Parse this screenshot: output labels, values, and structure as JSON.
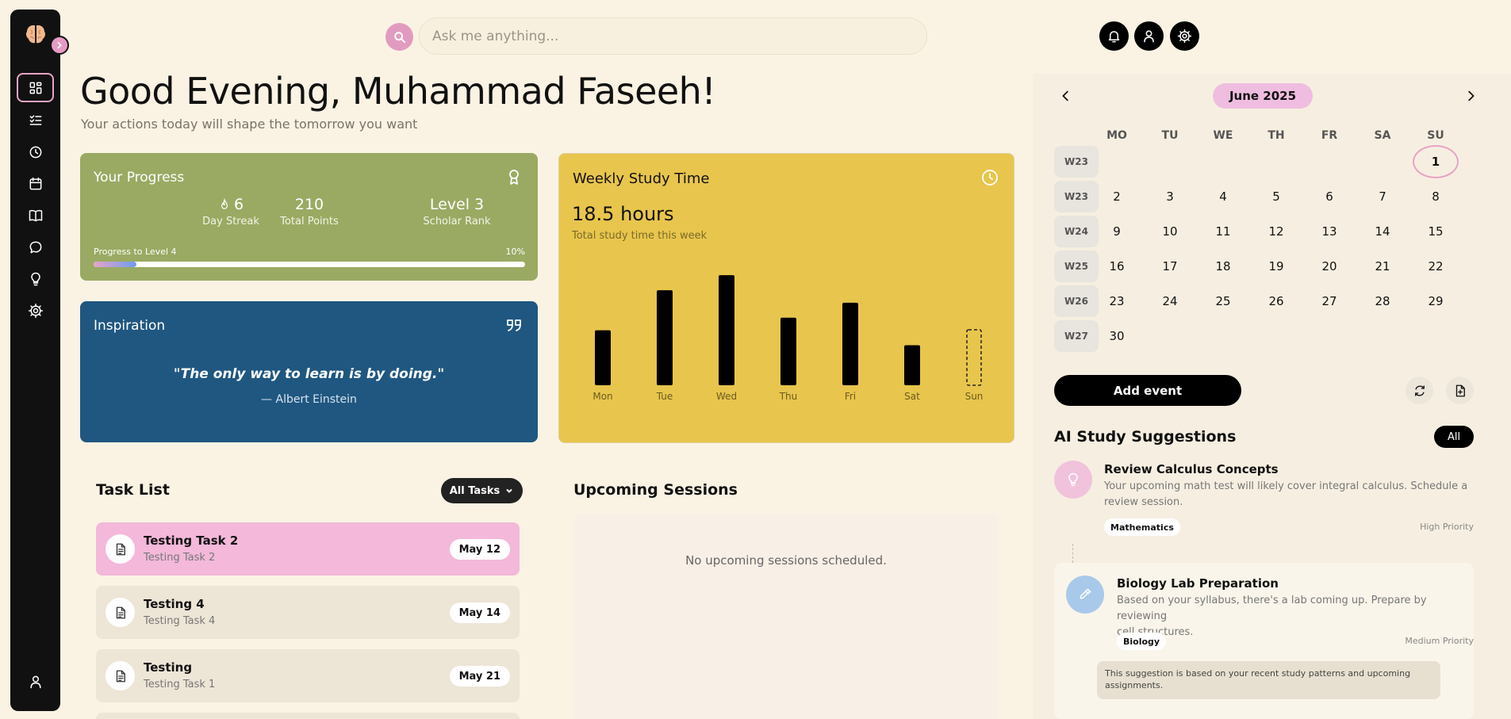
{
  "search": {
    "placeholder": "Ask me anything..."
  },
  "greeting": {
    "title": "Good Evening, Muhammad Faseeh!",
    "subtitle": "Your actions today will shape the tomorrow you want"
  },
  "progress": {
    "title": "Your Progress",
    "stats": [
      {
        "value": "6",
        "label": "Day Streak"
      },
      {
        "value": "210",
        "label": "Total Points"
      },
      {
        "value": "Level 3",
        "label": "Scholar Rank"
      }
    ],
    "bar_label": "Progress to Level 4",
    "bar_percent_text": "10%",
    "bar_fraction": 0.1
  },
  "inspiration": {
    "title": "Inspiration",
    "quote": "\"The only way to learn is by doing.\"",
    "author": "— Albert Einstein"
  },
  "study": {
    "title": "Weekly Study Time",
    "hours": "18.5 hours",
    "subtitle": "Total study time this week"
  },
  "chart_data": {
    "type": "bar",
    "categories": [
      "Mon",
      "Tue",
      "Wed",
      "Thu",
      "Fri",
      "Sat",
      "Sun"
    ],
    "values": [
      2.2,
      3.8,
      4.4,
      2.7,
      3.3,
      1.6,
      0
    ],
    "ylim": [
      0,
      4.5
    ],
    "grid": false,
    "colors": {
      "bar": "#000000",
      "background": "#e8c54c"
    }
  },
  "tasks": {
    "title": "Task List",
    "filter_label": "All Tasks",
    "items": [
      {
        "title": "Testing Task 2",
        "subtitle": "Testing Task 2",
        "date": "May 12"
      },
      {
        "title": "Testing 4",
        "subtitle": "Testing Task 4",
        "date": "May 14"
      },
      {
        "title": "Testing",
        "subtitle": "Testing Task 1",
        "date": "May 21"
      }
    ]
  },
  "upcoming": {
    "title": "Upcoming Sessions",
    "empty_text": "No upcoming sessions scheduled."
  },
  "calendar": {
    "month": "June 2025",
    "weekdays": [
      "MO",
      "TU",
      "WE",
      "TH",
      "FR",
      "SA",
      "SU"
    ],
    "weeks": [
      "W23",
      "W23",
      "W24",
      "W25",
      "W26",
      "W27"
    ],
    "days": [
      [
        "",
        "",
        "",
        "",
        "",
        "",
        "1"
      ],
      [
        "2",
        "3",
        "4",
        "5",
        "6",
        "7",
        "8"
      ],
      [
        "9",
        "10",
        "11",
        "12",
        "13",
        "14",
        "15"
      ],
      [
        "16",
        "17",
        "18",
        "19",
        "20",
        "21",
        "22"
      ],
      [
        "23",
        "24",
        "25",
        "26",
        "27",
        "28",
        "29"
      ],
      [
        "30",
        "",
        "",
        "",
        "",
        "",
        ""
      ]
    ],
    "add_event_label": "Add event"
  },
  "ai": {
    "title": "AI Study Suggestions",
    "filter_label": "All",
    "suggestions": [
      {
        "title": "Review Calculus Concepts",
        "desc_line1": "Your upcoming math test will likely cover integral calculus. Schedule a",
        "desc_line2": "review session.",
        "tag": "Mathematics",
        "priority": "High Priority"
      },
      {
        "title": "Biology Lab Preparation",
        "desc_line1": "Based on your syllabus, there's a lab coming up. Prepare by reviewing",
        "desc_line2": "cell structures.",
        "tag": "Biology",
        "priority": "Medium Priority",
        "note": "This suggestion is based on your recent study patterns and upcoming assignments."
      }
    ]
  },
  "colors": {
    "background": "#faf3e4",
    "sidebar": "#111111",
    "accent_pink": "#e29bc0",
    "progress_card": "#9aaa63",
    "inspiration_card": "#1f5781",
    "study_card": "#e8c54c",
    "task_highlight": "#f3b8da"
  }
}
